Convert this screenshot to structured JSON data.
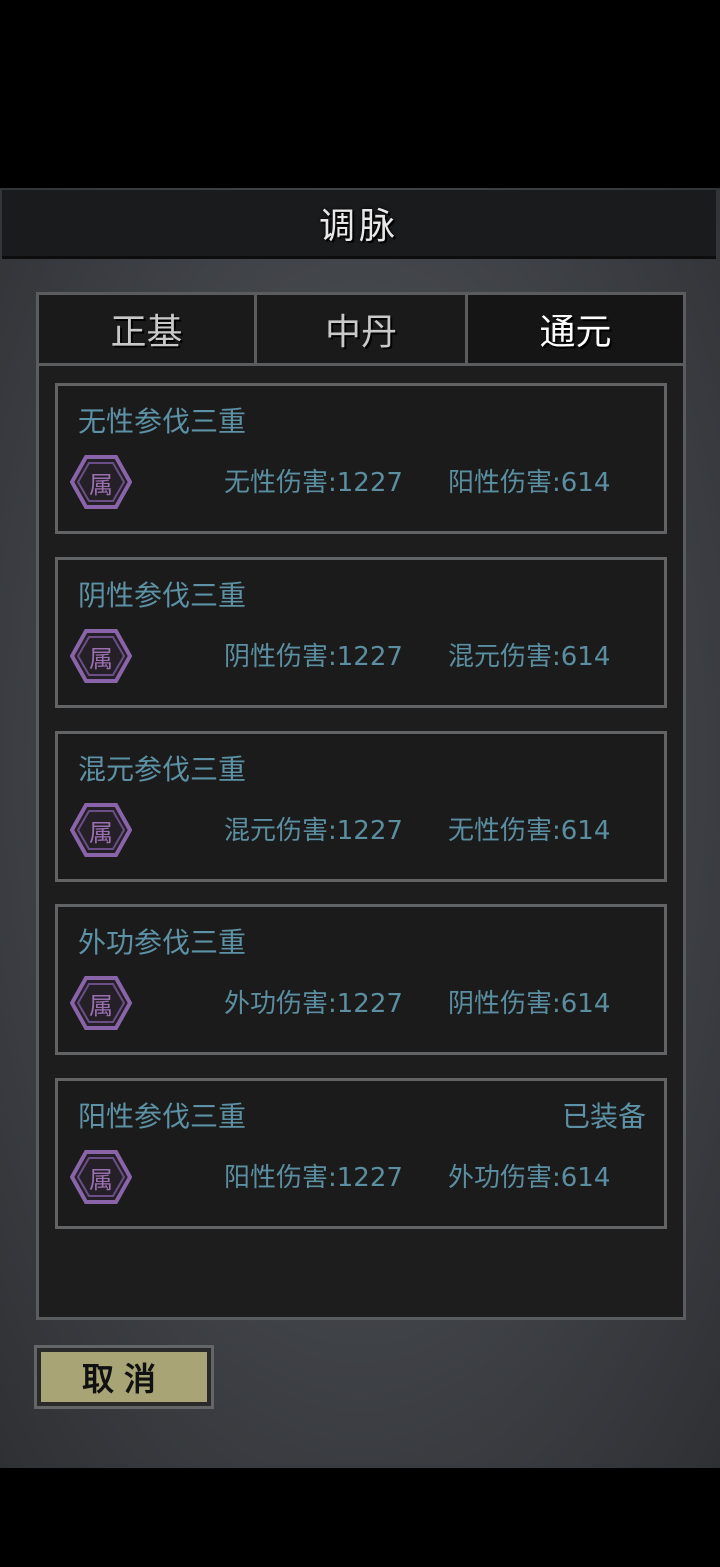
{
  "title": "调脉",
  "tabs": [
    {
      "label": "正基"
    },
    {
      "label": "中丹"
    },
    {
      "label": "通元"
    }
  ],
  "active_tab": 2,
  "cards": [
    {
      "name": "无性参伐三重",
      "badge": "属",
      "stat1": "无性伤害:1227",
      "stat2": "阳性伤害:614",
      "status": ""
    },
    {
      "name": "阴性参伐三重",
      "badge": "属",
      "stat1": "阴性伤害:1227",
      "stat2": "混元伤害:614",
      "status": ""
    },
    {
      "name": "混元参伐三重",
      "badge": "属",
      "stat1": "混元伤害:1227",
      "stat2": "无性伤害:614",
      "status": ""
    },
    {
      "name": "外功参伐三重",
      "badge": "属",
      "stat1": "外功伤害:1227",
      "stat2": "阴性伤害:614",
      "status": ""
    },
    {
      "name": "阳性参伐三重",
      "badge": "属",
      "stat1": "阳性伤害:1227",
      "stat2": "外功伤害:614",
      "status": "已装备"
    }
  ],
  "cancel_label": "取消",
  "colors": {
    "name_text": "#5d92a6",
    "badge_hex": "#8a64a8",
    "cancel_bg": "#a8a475"
  }
}
